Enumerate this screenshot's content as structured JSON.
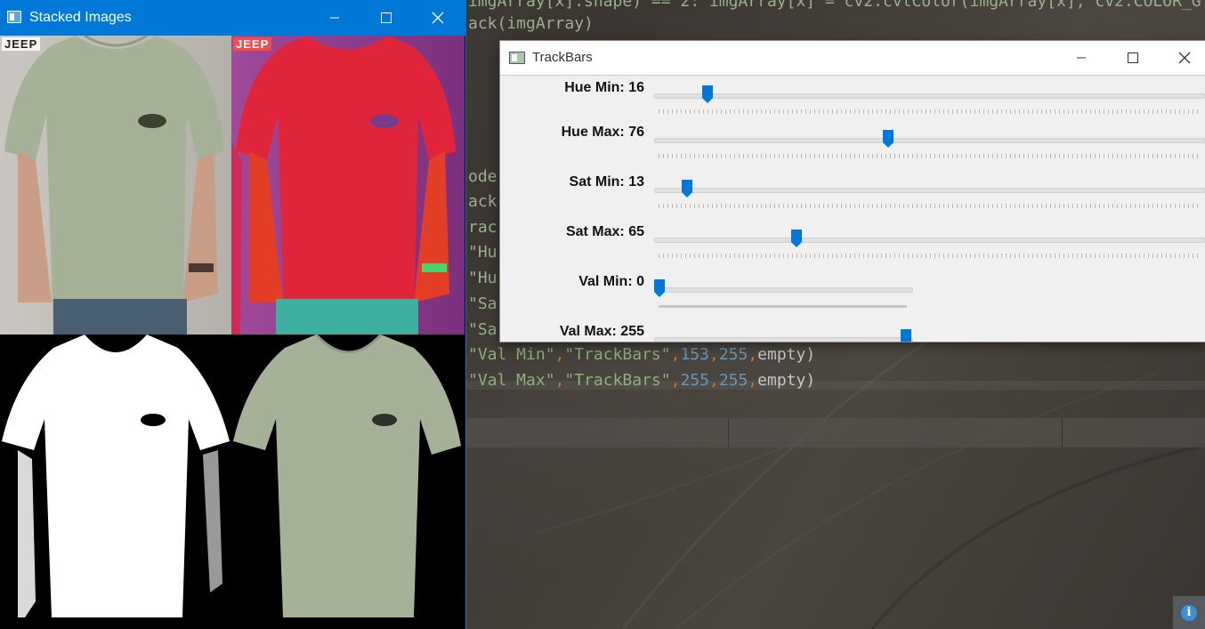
{
  "editor": {
    "lines": [
      {
        "text": "imgArray[x].shape) == 2: imgArray[x] = cv2.cvtColor(imgArray[x], cv2.COLOR_G"
      },
      {
        "text": "ack(imgArray)"
      },
      {
        "text": "ode"
      },
      {
        "text": "ack"
      },
      {
        "text": "rac"
      },
      {
        "text": "\"Hu"
      },
      {
        "text": "\"Hu"
      },
      {
        "text": "\"Sa"
      },
      {
        "text": "\"Sa"
      }
    ],
    "val_min_line": {
      "name": "\"Val Min\"",
      "window": "\"TrackBars\"",
      "value": "153",
      "max": "255",
      "fn": "empty)"
    },
    "val_max_line": {
      "name": "\"Val Max\"",
      "window": "\"TrackBars\"",
      "value": "255",
      "max": "255",
      "fn": "empty)"
    },
    "info_icon": "info-icon"
  },
  "stacked": {
    "title": "Stacked Images",
    "badge_tl": "JEEP",
    "badge_tr": "JEEP",
    "colors": {
      "titlebar": "#0078d7",
      "shirt": "#a8b49a",
      "hsv_red": "#e0243a",
      "hsv_magenta": "#b04898"
    }
  },
  "trackbars": {
    "title": "TrackBars",
    "controls": [
      {
        "label": "Hue Min: 16",
        "value": 16,
        "max": 179,
        "short": false
      },
      {
        "label": "Hue Max: 76",
        "value": 76,
        "max": 179,
        "short": false
      },
      {
        "label": "Sat Min: 13",
        "value": 13,
        "max": 255,
        "short": false
      },
      {
        "label": "Sat Max: 65",
        "value": 65,
        "max": 255,
        "short": false
      },
      {
        "label": "Val Min: 0",
        "value": 0,
        "max": 255,
        "short": true
      },
      {
        "label": "Val Max: 255",
        "value": 255,
        "max": 255,
        "short": true
      }
    ],
    "accent": "#0078d7"
  }
}
